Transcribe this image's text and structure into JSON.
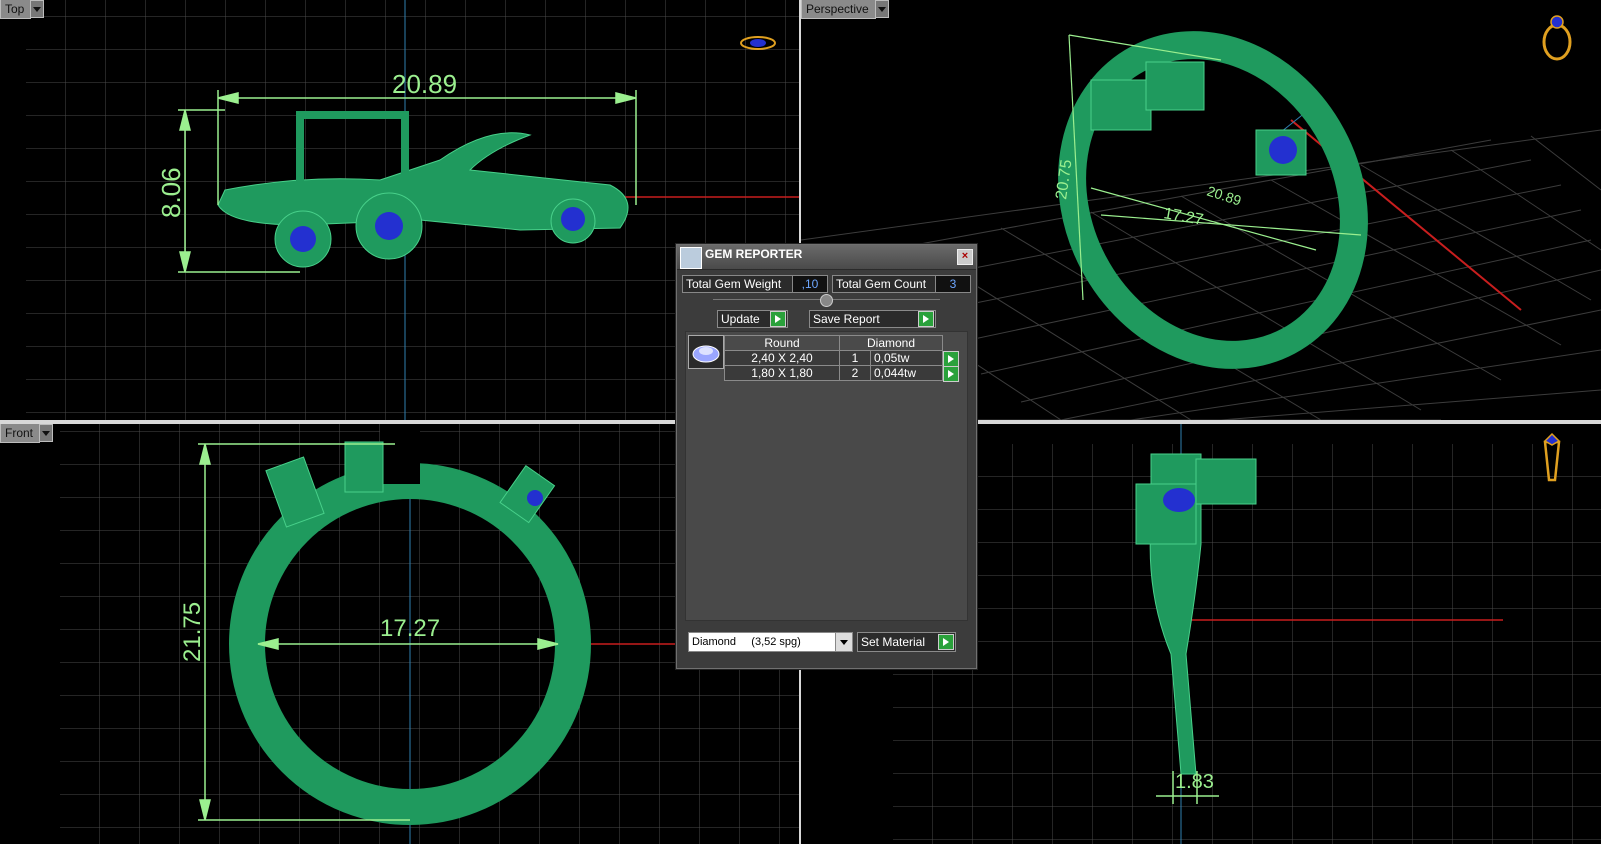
{
  "viewports": {
    "top": {
      "label": "Top",
      "dims": {
        "width": "20.89",
        "height": "8.06"
      }
    },
    "perspective": {
      "label": "Perspective",
      "dims": {
        "height": "20.75",
        "width": "20.89",
        "inner": "17.27"
      }
    },
    "front": {
      "label": "Front",
      "dims": {
        "height": "21.75",
        "inner": "17.27"
      }
    },
    "side": {
      "dims": {
        "shank": "1.83"
      }
    }
  },
  "gem_reporter": {
    "title": "GEM REPORTER",
    "close": "×",
    "total_weight_label": "Total Gem Weight",
    "total_weight_value": ",10",
    "total_count_label": "Total Gem Count",
    "total_count_value": "3",
    "update_label": "Update",
    "save_label": "Save Report",
    "table": {
      "headers": [
        "Round",
        "Diamond"
      ],
      "rows": [
        {
          "size": "2,40 X 2,40",
          "count": "1",
          "weight": "0,05tw"
        },
        {
          "size": "1,80 X 1,80",
          "count": "2",
          "weight": "0,044tw"
        }
      ]
    },
    "material_select": "Diamond     (3,52 spg)",
    "set_material_label": "Set Material"
  },
  "colors": {
    "grid": "#3a3a3a",
    "ring": "#1f9a5e",
    "dimension": "#9bef8f",
    "gem": "#2330d0",
    "axis_red": "#c81e1e",
    "axis_blue": "#2f7fb0"
  }
}
